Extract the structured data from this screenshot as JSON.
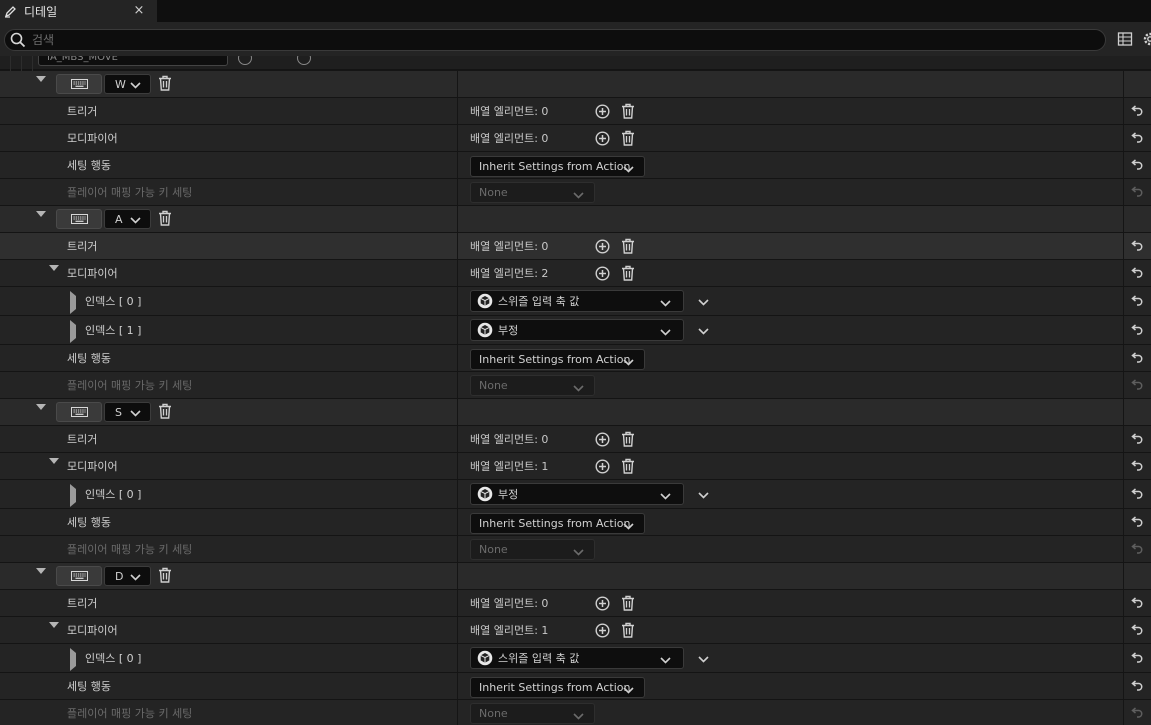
{
  "tab": {
    "title": "디테일",
    "close": "×"
  },
  "search": {
    "placeholder": "검색"
  },
  "header": {
    "action_name": "IA_MBS_MOVE"
  },
  "labels": {
    "trigger": "트리거",
    "modifier": "모디파이어",
    "settings_behavior": "세팅 행동",
    "player_mappable": "플레이어 매핑 가능 키 세팅",
    "array_prefix": "배열 엘리먼트: ",
    "inherit": "Inherit Settings from Action",
    "none": "None"
  },
  "mappings": [
    {
      "key": "W",
      "trigger_count": "0",
      "modifier_count": "0",
      "modifiers": []
    },
    {
      "key": "A",
      "trigger_count": "0",
      "modifier_count": "2",
      "modifiers": [
        {
          "index_label": "인덱스 [ 0 ]",
          "value": "스위즐 입력 축 값"
        },
        {
          "index_label": "인덱스 [ 1 ]",
          "value": "부정"
        }
      ]
    },
    {
      "key": "S",
      "trigger_count": "0",
      "modifier_count": "1",
      "modifiers": [
        {
          "index_label": "인덱스 [ 0 ]",
          "value": "부정"
        }
      ]
    },
    {
      "key": "D",
      "trigger_count": "0",
      "modifier_count": "1",
      "modifiers": [
        {
          "index_label": "인덱스 [ 0 ]",
          "value": "스위즐 입력 축 값"
        }
      ]
    }
  ],
  "colors": {
    "panel": "#242424",
    "row_key": "#2a2a2a",
    "input_bg": "#0e0e0e",
    "text": "#cfcfcf"
  }
}
